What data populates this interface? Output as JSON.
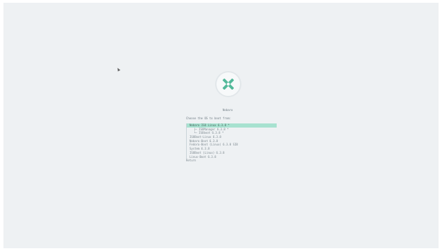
{
  "bootloader": {
    "title": "Nobara",
    "prompt": "Choose the OS to boot from:",
    "entries": [
      {
        "label": "Nobara ISO Linux  6.3.8 *",
        "selected": true,
        "sub": false
      },
      {
        "label": "├─ ISOManager  6.3.8 *",
        "selected": false,
        "sub": true
      },
      {
        "label": "└─ ISOboot  6.3.8 *",
        "selected": false,
        "sub": true
      },
      {
        "label": "ISOBoot-Linux  6.3.8",
        "selected": false,
        "sub": false
      },
      {
        "label": "Nobara-Boot  6.3.8",
        "selected": false,
        "sub": false
      },
      {
        "label": "Fedora-Boot (Linux)  6.3.8 SIB",
        "selected": false,
        "sub": false
      },
      {
        "label": "System  6.3.8",
        "selected": false,
        "sub": false
      },
      {
        "label": "ISOBoot (Linux)  6.3.8",
        "selected": false,
        "sub": false
      },
      {
        "label": "Linux-Boot  6.3.8",
        "selected": false,
        "sub": false
      },
      {
        "label": "Return",
        "selected": false,
        "sub": false,
        "plain": true
      }
    ]
  },
  "icons": {
    "logo": "x-cross-logo-icon",
    "cursor": "mouse-pointer-icon"
  },
  "colors": {
    "background": "#eef1f3",
    "accent": "#53b99a",
    "selection": "#a7e2d0",
    "text": "#6d7a82"
  }
}
